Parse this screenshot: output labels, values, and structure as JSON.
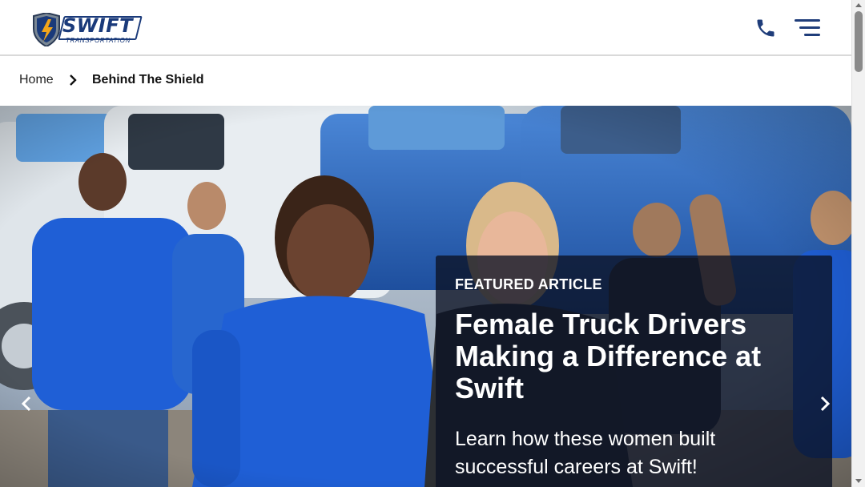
{
  "header": {
    "logo_text": "SWIFT",
    "logo_subtext": "TRANSPORTATION",
    "phone_icon": "phone-icon",
    "menu_icon": "hamburger-menu-icon"
  },
  "breadcrumb": {
    "home": "Home",
    "separator_icon": "chevron-right-icon",
    "current": "Behind The Shield"
  },
  "hero": {
    "featured_label": "FEATURED ARTICLE",
    "title": "Female Truck Drivers Making a Difference at Swift",
    "description": "Learn how these women built successful careers at Swift!",
    "prev_icon": "chevron-left-icon",
    "next_icon": "chevron-right-icon"
  },
  "colors": {
    "brand_navy": "#1a3a7a",
    "card_bg": "#0c1224",
    "shirt_blue": "#1f5fd6"
  }
}
